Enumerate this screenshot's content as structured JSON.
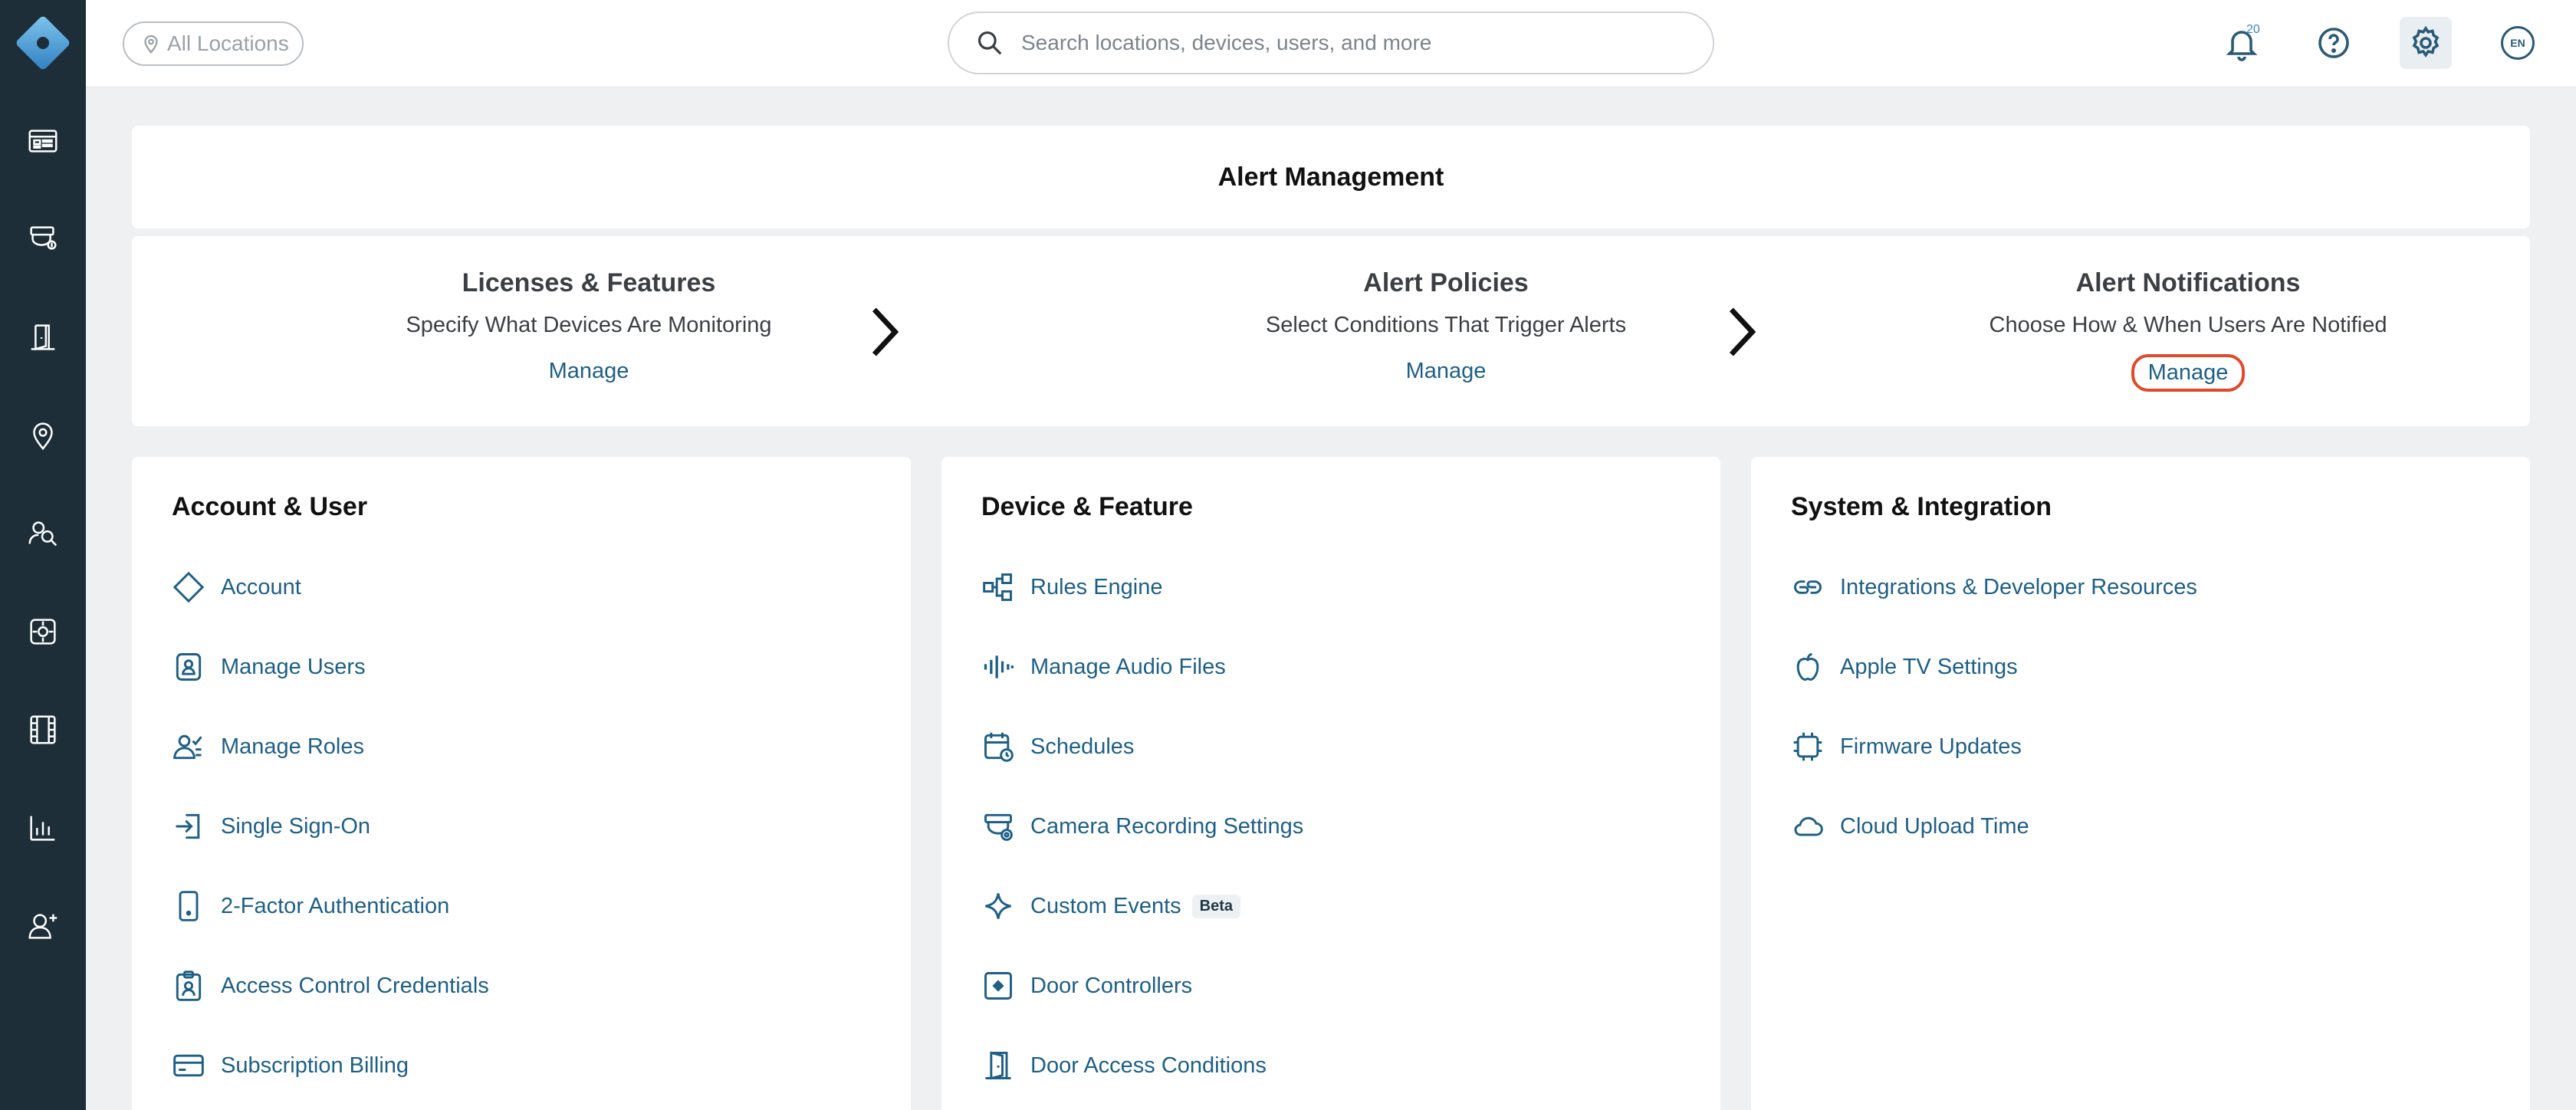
{
  "topbar": {
    "location_label": "All Locations",
    "search_placeholder": "Search locations, devices, users, and more",
    "notification_count": "20",
    "language": "EN"
  },
  "alert_management": {
    "title": "Alert Management",
    "steps": [
      {
        "title": "Licenses & Features",
        "desc": "Specify What Devices Are Monitoring",
        "link": "Manage"
      },
      {
        "title": "Alert Policies",
        "desc": "Select Conditions That Trigger Alerts",
        "link": "Manage"
      },
      {
        "title": "Alert Notifications",
        "desc": "Choose How & When Users Are Notified",
        "link": "Manage"
      }
    ]
  },
  "cards": {
    "account": {
      "title": "Account & User",
      "items": [
        "Account",
        "Manage Users",
        "Manage Roles",
        "Single Sign-On",
        "2-Factor Authentication",
        "Access Control Credentials",
        "Subscription Billing"
      ]
    },
    "device": {
      "title": "Device & Feature",
      "items": [
        "Rules Engine",
        "Manage Audio Files",
        "Schedules",
        "Camera Recording Settings",
        "Custom Events",
        "Door Controllers",
        "Door Access Conditions"
      ],
      "beta_label": "Beta"
    },
    "system": {
      "title": "System & Integration",
      "items": [
        "Integrations & Developer Resources",
        "Apple TV Settings",
        "Firmware Updates",
        "Cloud Upload Time"
      ]
    }
  },
  "colors": {
    "sidebar_bg": "#1d2e38",
    "link": "#1e5f86",
    "highlight": "#e04a2a",
    "page_bg": "#eef0f2"
  }
}
